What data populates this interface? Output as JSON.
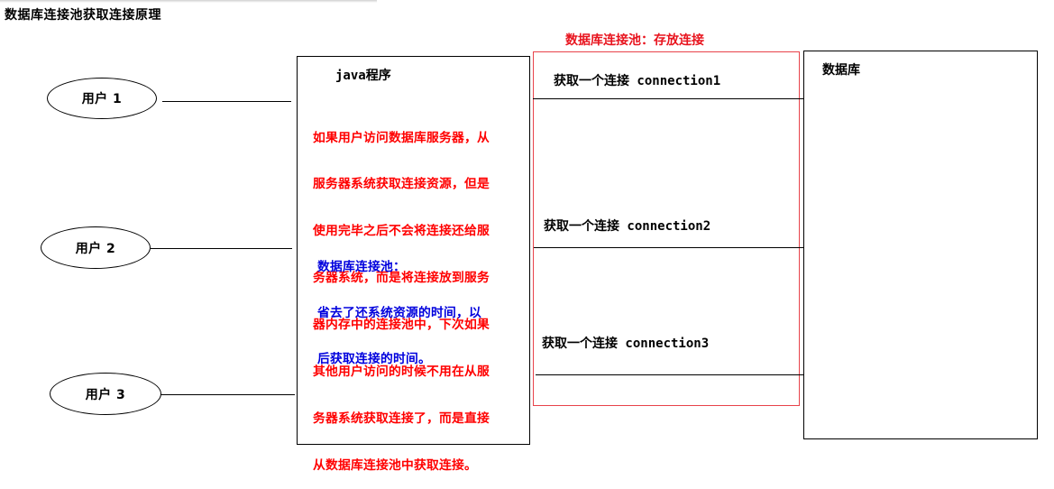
{
  "title": "数据库连接池获取连接原理",
  "users": [
    "用户 1",
    "用户 2",
    "用户 3"
  ],
  "java_box": {
    "label": "java程序",
    "red_note_lines": [
      "如果用户访问数据库服务器，从",
      "服务器系统获取连接资源，但是",
      "使用完毕之后不会将连接还给服",
      "务器系统，而是将连接放到服务",
      "器内存中的连接池中，下次如果",
      "其他用户访问的时候不用在从服",
      "务器系统获取连接了，而是直接",
      "从数据库连接池中获取连接。"
    ],
    "blue_note_lines": [
      "数据库连接池：",
      "省去了还系统资源的时间，以",
      "后获取连接的时间。"
    ]
  },
  "pool": {
    "title": "数据库连接池：存放连接",
    "connections": [
      "获取一个连接 connection1",
      "获取一个连接 connection2",
      "获取一个连接 connection3"
    ]
  },
  "database": {
    "label": "数据库"
  },
  "colors": {
    "red": "#ff0000",
    "pool_border": "#e8434a",
    "blue": "#0000dd"
  }
}
